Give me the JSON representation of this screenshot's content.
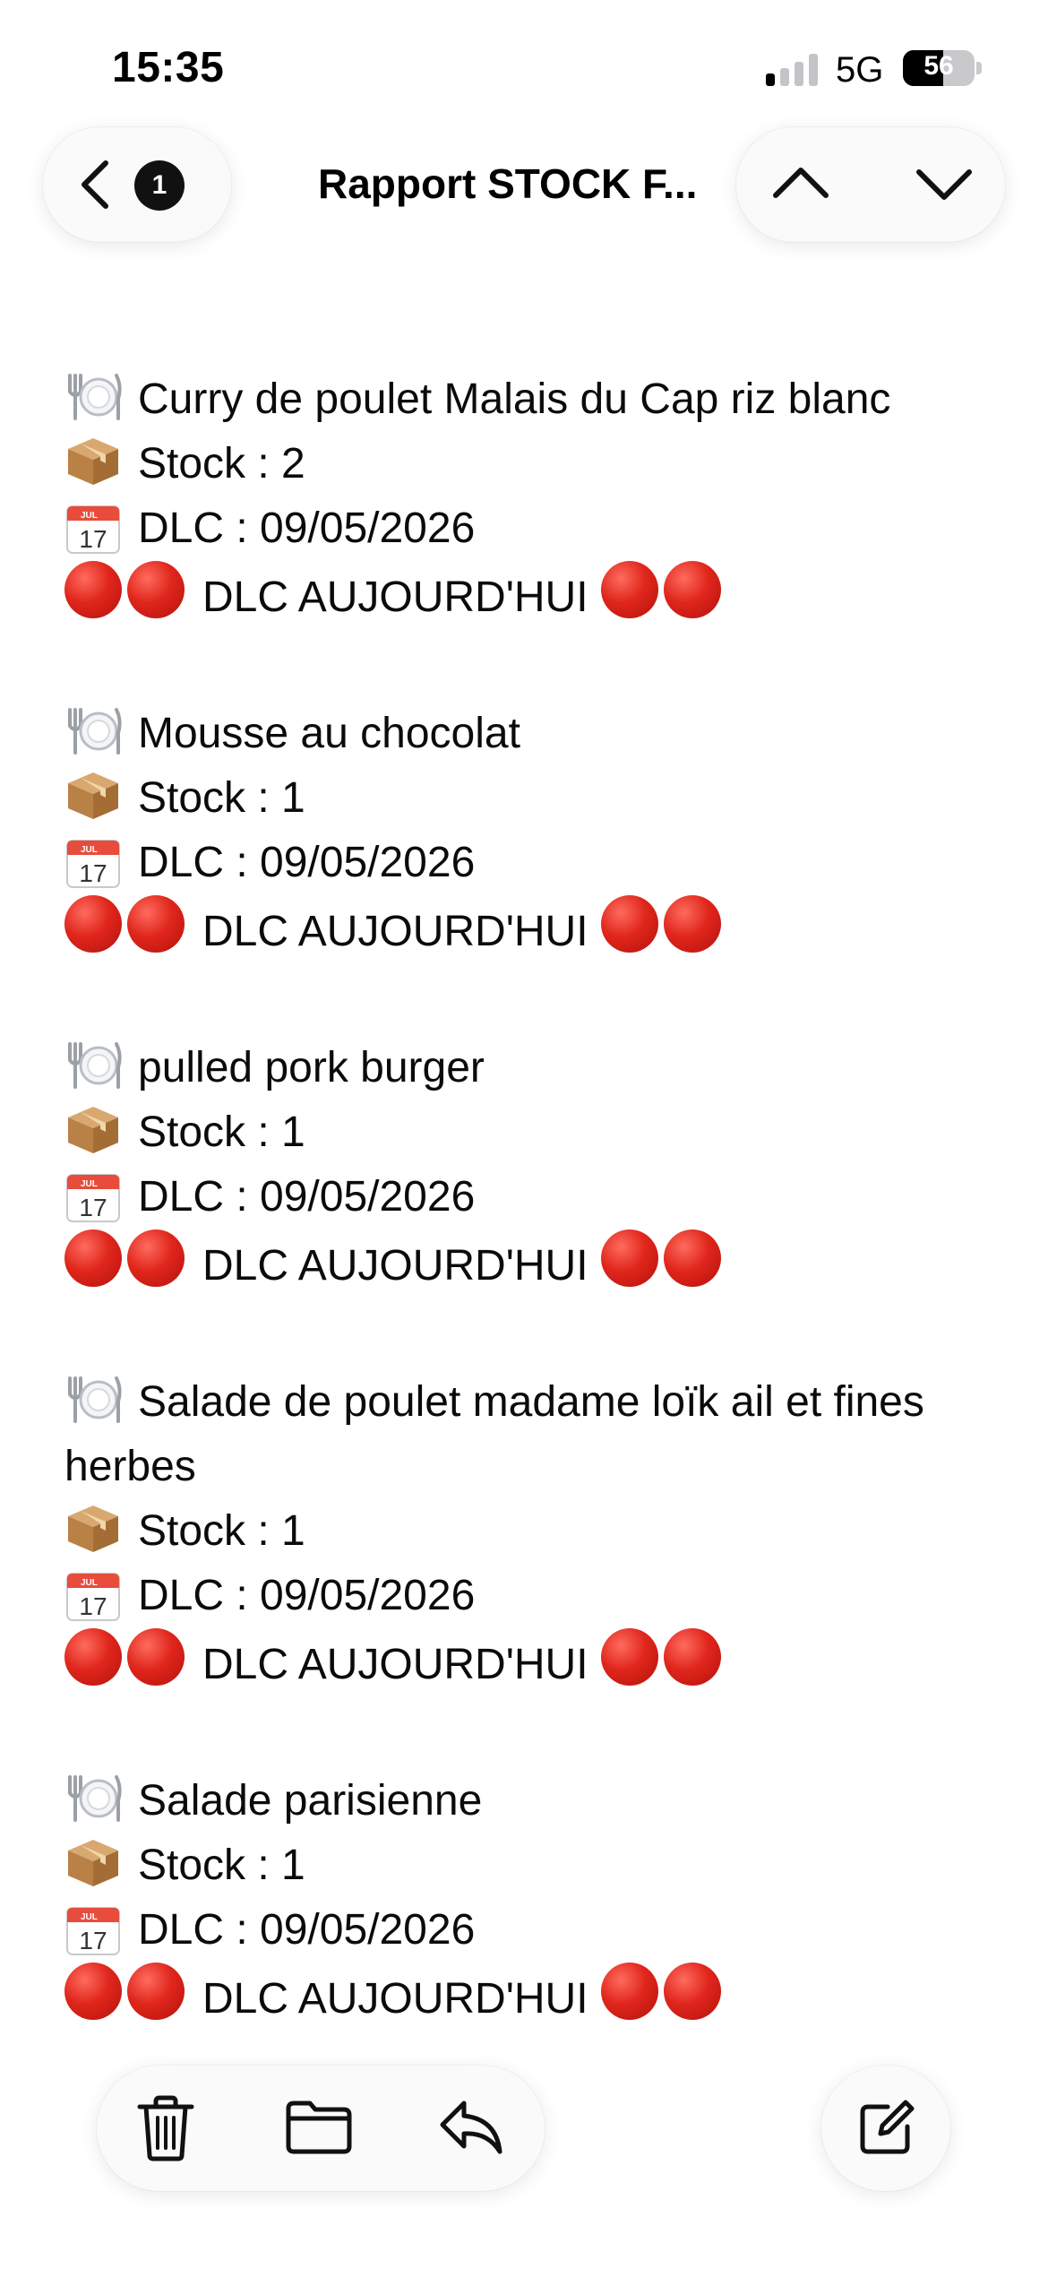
{
  "status_bar": {
    "time": "15:35",
    "network": "5G",
    "battery_level": "56",
    "battery_percent": 56,
    "signal_bars_active": 1,
    "signal_bars_total": 4
  },
  "nav": {
    "unread_count": "1",
    "title": "Rapport STOCK F...",
    "icons": [
      "chevron-left-icon",
      "chevron-up-icon",
      "chevron-down-icon"
    ]
  },
  "message": {
    "items": [
      {
        "name_lines": [
          "Curry de poulet Malais du Cap riz blanc"
        ],
        "stock": "Stock : 2",
        "dlc": "DLC : 09/05/2026",
        "alert": "DLC AUJOURD'HUI"
      },
      {
        "name_lines": [
          "Mousse au chocolat"
        ],
        "stock": "Stock : 1",
        "dlc": "DLC : 09/05/2026",
        "alert": "DLC AUJOURD'HUI"
      },
      {
        "name_lines": [
          "pulled pork burger"
        ],
        "stock": "Stock : 1",
        "dlc": "DLC : 09/05/2026",
        "alert": "DLC AUJOURD'HUI"
      },
      {
        "name_lines": [
          "Salade de poulet madame loïk ail et fines",
          "herbes"
        ],
        "stock": "Stock : 1",
        "dlc": "DLC : 09/05/2026",
        "alert": "DLC AUJOURD'HUI"
      },
      {
        "name_lines": [
          "Salade parisienne"
        ],
        "stock": "Stock : 1",
        "dlc": "DLC : 09/05/2026",
        "alert": "DLC AUJOURD'HUI"
      }
    ],
    "item_icons": [
      "plate-icon",
      "package-icon",
      "calendar-icon",
      "red-circle-icon"
    ],
    "calendar_icon_text": {
      "month": "JUL",
      "day": "17"
    }
  },
  "toolbar": {
    "icons": [
      "trash-icon",
      "folder-icon",
      "reply-icon",
      "compose-icon"
    ]
  },
  "colors": {
    "alert_red": "#e0261c",
    "text": "#0b0b0b",
    "pill_background": "#fafafa"
  }
}
